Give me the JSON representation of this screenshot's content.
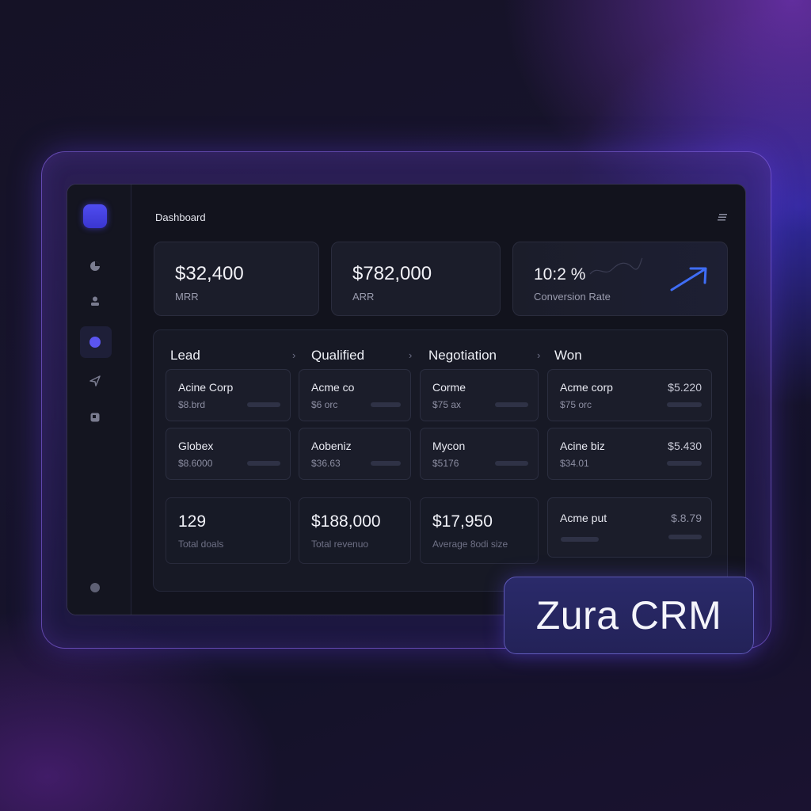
{
  "header": {
    "title": "Dashboard"
  },
  "kpis": [
    {
      "value": "$32,400",
      "label": "MRR"
    },
    {
      "value": "$782,000",
      "label": "ARR"
    },
    {
      "value": "10:2 %",
      "label": "Conversion Rate"
    }
  ],
  "sidebar": {
    "items": [
      {
        "icon": "pie-chart-icon"
      },
      {
        "icon": "user-icon"
      },
      {
        "icon": "circle-icon",
        "active": true
      },
      {
        "icon": "send-icon"
      },
      {
        "icon": "calendar-icon"
      },
      {
        "icon": "settings-dot-icon"
      }
    ]
  },
  "pipeline": {
    "stages": [
      "Lead",
      "Qualified",
      "Negotiation",
      "Won"
    ],
    "cards": [
      [
        {
          "name": "Acine Corp",
          "sub": "$8.brd"
        },
        {
          "name": "Globex",
          "sub": "$8.6000"
        }
      ],
      [
        {
          "name": "Acme co",
          "sub": "$6 orc"
        },
        {
          "name": "Aobeniz",
          "sub": "$36.63"
        }
      ],
      [
        {
          "name": "Corme",
          "sub": "$75 ax"
        },
        {
          "name": "Mycon",
          "sub": "$5176"
        }
      ],
      [
        {
          "name": "Acme corp",
          "sub": "$75 orc",
          "amount": "$5.220"
        },
        {
          "name": "Acine biz",
          "sub": "$34.01",
          "amount": "$5.430"
        }
      ]
    ],
    "stats": [
      {
        "value": "129",
        "label": "Total doals"
      },
      {
        "value": "$188,000",
        "label": "Total revenuo"
      },
      {
        "value": "$17,950",
        "label": "Average 8odi size"
      }
    ],
    "extra_card": {
      "name": "Acme put",
      "amount": "$.8.79"
    }
  },
  "brand": {
    "name": "Zura CRM"
  },
  "colors": {
    "accent": "#4f4cf0",
    "background": "#12131d",
    "card": "#1b1d2a"
  }
}
